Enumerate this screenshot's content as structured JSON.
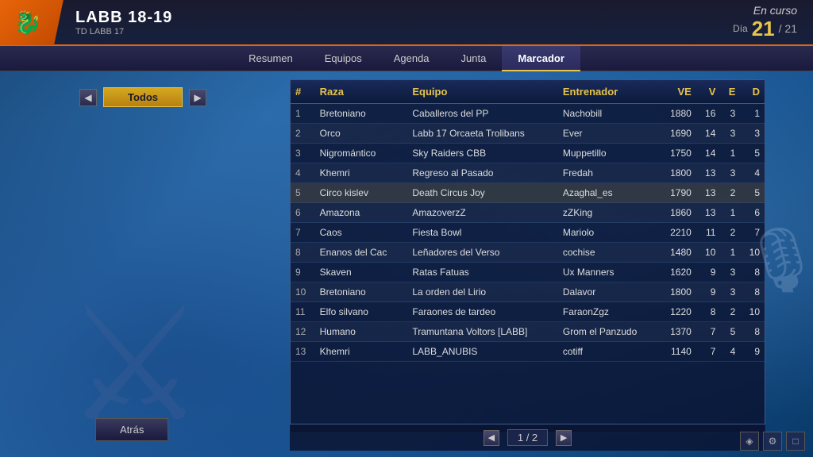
{
  "header": {
    "league_title": "LABB 18-19",
    "league_subtitle": "TD LABB 17",
    "status": "En curso",
    "day_label": "Día",
    "day_current": "21",
    "day_separator": "/",
    "day_total": "21"
  },
  "nav": {
    "tabs": [
      {
        "id": "resumen",
        "label": "Resumen",
        "active": false
      },
      {
        "id": "equipos",
        "label": "Equipos",
        "active": false
      },
      {
        "id": "agenda",
        "label": "Agenda",
        "active": false
      },
      {
        "id": "junta",
        "label": "Junta",
        "active": false
      },
      {
        "id": "marcador",
        "label": "Marcador",
        "active": true
      }
    ]
  },
  "filter": {
    "label": "Todos"
  },
  "table": {
    "headers": {
      "num": "#",
      "raza": "Raza",
      "equipo": "Equipo",
      "entrenador": "Entrenador",
      "ve": "VE",
      "v": "V",
      "e": "E",
      "d": "D"
    },
    "rows": [
      {
        "num": 1,
        "raza": "Bretoniano",
        "equipo": "Caballeros del PP",
        "entrenador": "Nachobill",
        "ve": 1880,
        "v": 16,
        "e": 3,
        "d": 1
      },
      {
        "num": 2,
        "raza": "Orco",
        "equipo": "Labb 17 Orcaeta Trolibans",
        "entrenador": "Ever",
        "ve": 1690,
        "v": 14,
        "e": 3,
        "d": 3
      },
      {
        "num": 3,
        "raza": "Nigromántico",
        "equipo": "Sky Raiders CBB",
        "entrenador": "Muppetillo",
        "ve": 1750,
        "v": 14,
        "e": 1,
        "d": 5
      },
      {
        "num": 4,
        "raza": "Khemri",
        "equipo": "Regreso al Pasado",
        "entrenador": "Fredah",
        "ve": 1800,
        "v": 13,
        "e": 3,
        "d": 4
      },
      {
        "num": 5,
        "raza": "Circo kislev",
        "equipo": "Death Circus Joy",
        "entrenador": "Azaghal_es",
        "ve": 1790,
        "v": 13,
        "e": 2,
        "d": 5,
        "highlighted": true
      },
      {
        "num": 6,
        "raza": "Amazona",
        "equipo": "AmazoverzZ",
        "entrenador": "zZKing",
        "ve": 1860,
        "v": 13,
        "e": 1,
        "d": 6
      },
      {
        "num": 7,
        "raza": "Caos",
        "equipo": "Fiesta Bowl",
        "entrenador": "Mariolo",
        "ve": 2210,
        "v": 11,
        "e": 2,
        "d": 7
      },
      {
        "num": 8,
        "raza": "Enanos del Cac",
        "equipo": "Leñadores del Verso",
        "entrenador": "cochise",
        "ve": 1480,
        "v": 10,
        "e": 1,
        "d": 10
      },
      {
        "num": 9,
        "raza": "Skaven",
        "equipo": "Ratas Fatuas",
        "entrenador": "Ux Manners",
        "ve": 1620,
        "v": 9,
        "e": 3,
        "d": 8
      },
      {
        "num": 10,
        "raza": "Bretoniano",
        "equipo": "La orden del Lirio",
        "entrenador": "Dalavor",
        "ve": 1800,
        "v": 9,
        "e": 3,
        "d": 8
      },
      {
        "num": 11,
        "raza": "Elfo silvano",
        "equipo": "Faraones de tardeo",
        "entrenador": "FaraonZgz",
        "ve": 1220,
        "v": 8,
        "e": 2,
        "d": 10
      },
      {
        "num": 12,
        "raza": "Humano",
        "equipo": "Tramuntana Voltors [LABB]",
        "entrenador": "Grom el Panzudo",
        "ve": 1370,
        "v": 7,
        "e": 5,
        "d": 8
      },
      {
        "num": 13,
        "raza": "Khemri",
        "equipo": "LABB_ANUBIS",
        "entrenador": "cotiff",
        "ve": 1140,
        "v": 7,
        "e": 4,
        "d": 9
      }
    ]
  },
  "pagination": {
    "current": "1",
    "separator": "/",
    "total": "2"
  },
  "back_button": {
    "label": "Atrás"
  },
  "bottom_icons": [
    "◈",
    "⚙",
    "□"
  ]
}
